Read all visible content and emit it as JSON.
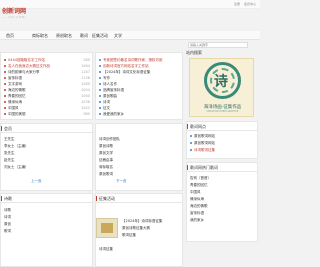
{
  "site": {
    "logo": "创新词网",
    "sub": "…..CJC.COM"
  },
  "top_links": [
    "注册",
    "会员中心"
  ],
  "nav": [
    "首页",
    "商标取名",
    "原创取名",
    "歌词",
    "征集活动",
    "文学"
  ],
  "left_panel": {
    "rows": [
      {
        "t": "0444回路取名字工作站",
        "n": "280"
      },
      {
        "t": "名人在我身边大赛征文作品",
        "n": "1064"
      },
      {
        "t": "诗的韵律与大家分享",
        "n": "1187"
      },
      {
        "t": "宣传标语",
        "n": "1156"
      },
      {
        "t": "文字游戏",
        "n": "1060"
      },
      {
        "t": "海边的情歌",
        "n": "1004"
      },
      {
        "t": "青春的回忆",
        "n": "1060"
      },
      {
        "t": "情深似海",
        "n": "1038"
      },
      {
        "t": "中国风",
        "n": "1042"
      },
      {
        "t": "中国的美丽",
        "n": "980"
      }
    ]
  },
  "mid_panel": {
    "rows": [
      {
        "t": "专家团签约著名诗词歌作家，授权可用",
        "n": ""
      },
      {
        "t": "创新诗词官方网站名字工作站",
        "n": ""
      },
      {
        "t": "【2024年】诗词文化标语征集",
        "n": ""
      },
      {
        "t": "写作",
        "n": ""
      },
      {
        "t": "诗人名作",
        "n": ""
      },
      {
        "t": "品牌宣传标语",
        "n": ""
      },
      {
        "t": "原创歌曲",
        "n": ""
      },
      {
        "t": "诗词",
        "n": ""
      },
      {
        "t": "征文",
        "n": ""
      },
      {
        "t": "我爱我的家乡",
        "n": ""
      }
    ]
  },
  "people_panel": {
    "title": "会员",
    "rows": [
      "王先生",
      "李女士（主编）",
      "张先生",
      "赵先生",
      "刘女士（主编）"
    ],
    "pager": [
      "上一页",
      "下一页"
    ]
  },
  "links_panel": {
    "rows": [
      "诗词创作团队",
      "原创诗歌",
      "原创文学",
      "征稿启事",
      "商标取名",
      "原创歌词",
      "原创诗歌"
    ]
  },
  "right_search": {
    "title": "站内搜索",
    "placeholder": "请输入关键字"
  },
  "stamp": {
    "char": "诗",
    "caption": "海洋诗画·征集作品",
    "small": "CREATIVE POEM ARCHIVE"
  },
  "right_list1": {
    "title": "歌词网点",
    "rows": [
      "原创歌词网站",
      "原创歌词网站",
      "诗词歌词征集"
    ]
  },
  "right_list2": {
    "title": "歌词网热门歌词",
    "rows": [
      "告别（首首）",
      "青春的回忆",
      "中国风",
      "情深似海",
      "海边的情歌",
      "宣传标语",
      "我的家乡"
    ]
  },
  "bottom_left": {
    "title": "诗歌",
    "rows": [
      "诗歌",
      "诗词",
      "原创",
      "歌词"
    ]
  },
  "bottom_mid": {
    "title": "征集活动",
    "rows": [
      "【2024年】诗词标语征集",
      "原创诗歌征集大赛",
      "歌词征集",
      "诗词征集"
    ],
    "badge": "创新活动"
  }
}
